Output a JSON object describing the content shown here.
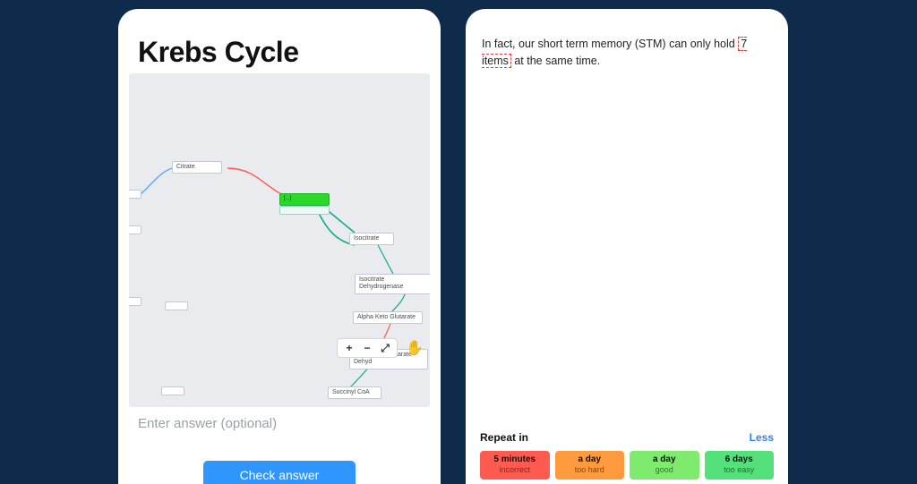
{
  "left": {
    "title": "Krebs Cycle",
    "answer_placeholder": "Enter answer (optional)",
    "check_label": "Check answer",
    "nodes": {
      "citrate": "Citrate",
      "active": "[...]",
      "isocitrate": "Isocitrate",
      "iso_dehyd": "Isocitrate Dehydrogenase",
      "akg": "Alpha Keto Glutarate",
      "akg_dehyd": "Alpha Keto Glutarate Dehyd",
      "succ_coa": "Succinyl CoA"
    },
    "toolbar": {
      "zoom_in": "+",
      "zoom_out": "−",
      "fit": "⤢",
      "hand": "✋"
    }
  },
  "right": {
    "text_pre": "In fact, our short term memory (STM) can only hold ",
    "highlight": "7 items",
    "text_post": " at the same time.",
    "repeat_label": "Repeat in",
    "less_label": "Less",
    "choices": [
      {
        "time": "5 minutes",
        "grade": "incorrect"
      },
      {
        "time": "a day",
        "grade": "too hard"
      },
      {
        "time": "a day",
        "grade": "good"
      },
      {
        "time": "6 days",
        "grade": "too easy"
      }
    ]
  }
}
